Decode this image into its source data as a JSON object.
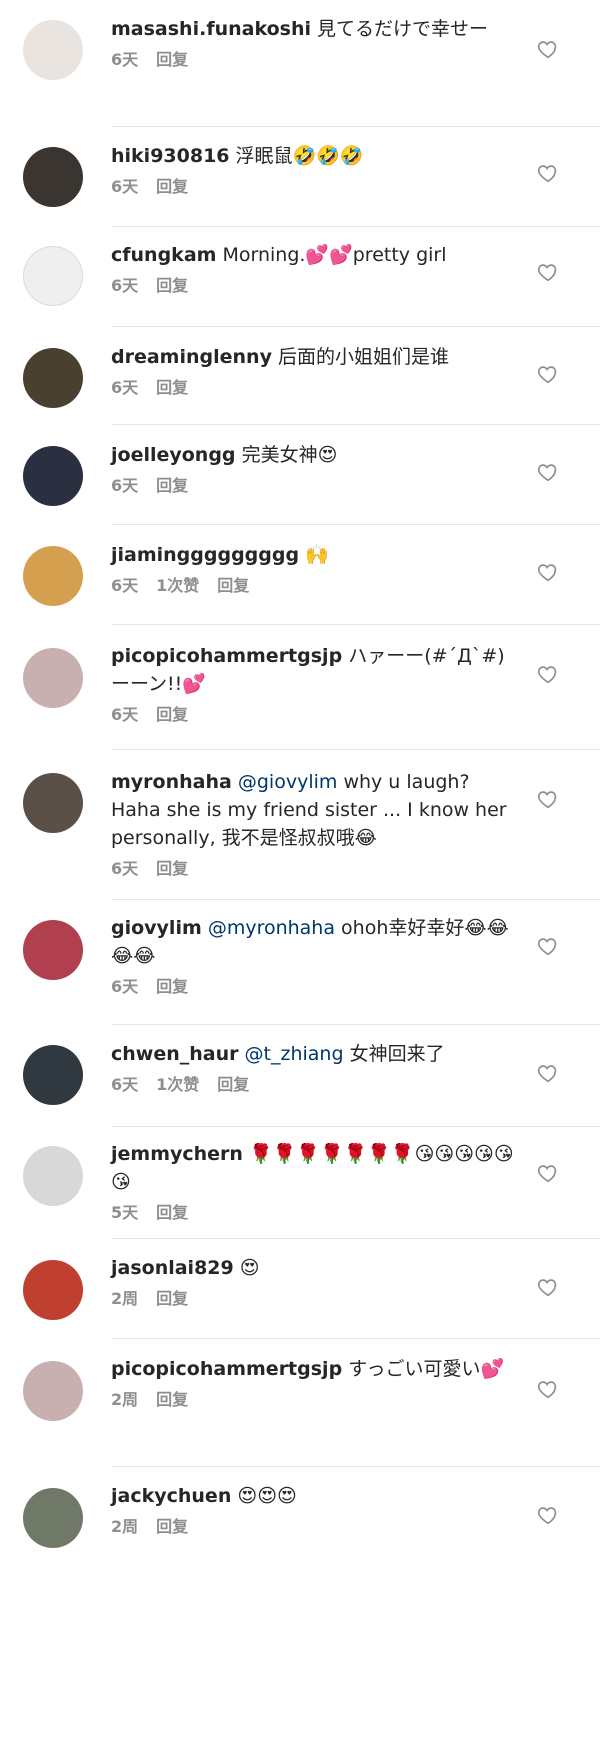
{
  "comments": [
    {
      "username": "masashi.funakoshi",
      "text": " 見てるだけで幸せー",
      "time": "6天",
      "likes": "",
      "reply": "回复",
      "avatar_color": "#e9e4e0"
    },
    {
      "username": "hiki930816",
      "text": " 浮眠鼠🤣🤣🤣",
      "time": "6天",
      "likes": "",
      "reply": "回复",
      "avatar_color": "#3a3530"
    },
    {
      "username": "cfungkam",
      "text": " Morning.💕💕pretty girl",
      "time": "6天",
      "likes": "",
      "reply": "回复",
      "avatar_color": "#efefef"
    },
    {
      "username": "dreaminglenny",
      "text": " 后面的小姐姐们是谁",
      "time": "6天",
      "likes": "",
      "reply": "回复",
      "avatar_color": "#4a4030"
    },
    {
      "username": "joelleyongg",
      "text": " 完美女神😍",
      "time": "6天",
      "likes": "",
      "reply": "回复",
      "avatar_color": "#2a3040"
    },
    {
      "username": "jiaminggggggggg",
      "text": " 🙌",
      "time": "6天",
      "likes": "1次赞",
      "reply": "回复",
      "avatar_color": "#d4a050"
    },
    {
      "username": "picopicohammertgsjp",
      "text": " ハァーー(#´Д`#)ーーン!!💕",
      "time": "6天",
      "likes": "",
      "reply": "回复",
      "avatar_color": "#c8b0b0"
    },
    {
      "username": "myronhaha",
      "mention": "@giovylim",
      "text": " why u laugh? Haha she is my friend sister ... I know her personally, 我不是怪叔叔哦😂",
      "time": "6天",
      "likes": "",
      "reply": "回复",
      "avatar_color": "#5a5048"
    },
    {
      "username": "giovylim",
      "mention": "@myronhaha",
      "text": " ohoh幸好幸好😂😂😂😂",
      "time": "6天",
      "likes": "",
      "reply": "回复",
      "avatar_color": "#b04050"
    },
    {
      "username": "chwen_haur",
      "mention": "@t_zhiang",
      "text": " 女神回来了",
      "time": "6天",
      "likes": "1次赞",
      "reply": "回复",
      "avatar_color": "#303840"
    },
    {
      "username": "jemmychern",
      "text": " 🌹🌹🌹🌹🌹🌹🌹😘😘😘😘😘😘",
      "time": "5天",
      "likes": "",
      "reply": "回复",
      "avatar_color": "#d8d8d8"
    },
    {
      "username": "jasonlai829",
      "text": " 😍",
      "time": "2周",
      "likes": "",
      "reply": "回复",
      "avatar_color": "#c04030"
    },
    {
      "username": "picopicohammertgsjp",
      "text": " すっごい可愛い💕",
      "time": "2周",
      "likes": "",
      "reply": "回复",
      "avatar_color": "#c8b0b0"
    },
    {
      "username": "jackychuen",
      "text": " 😍😍😍",
      "time": "2周",
      "likes": "",
      "reply": "回复",
      "avatar_color": "#707868"
    }
  ]
}
